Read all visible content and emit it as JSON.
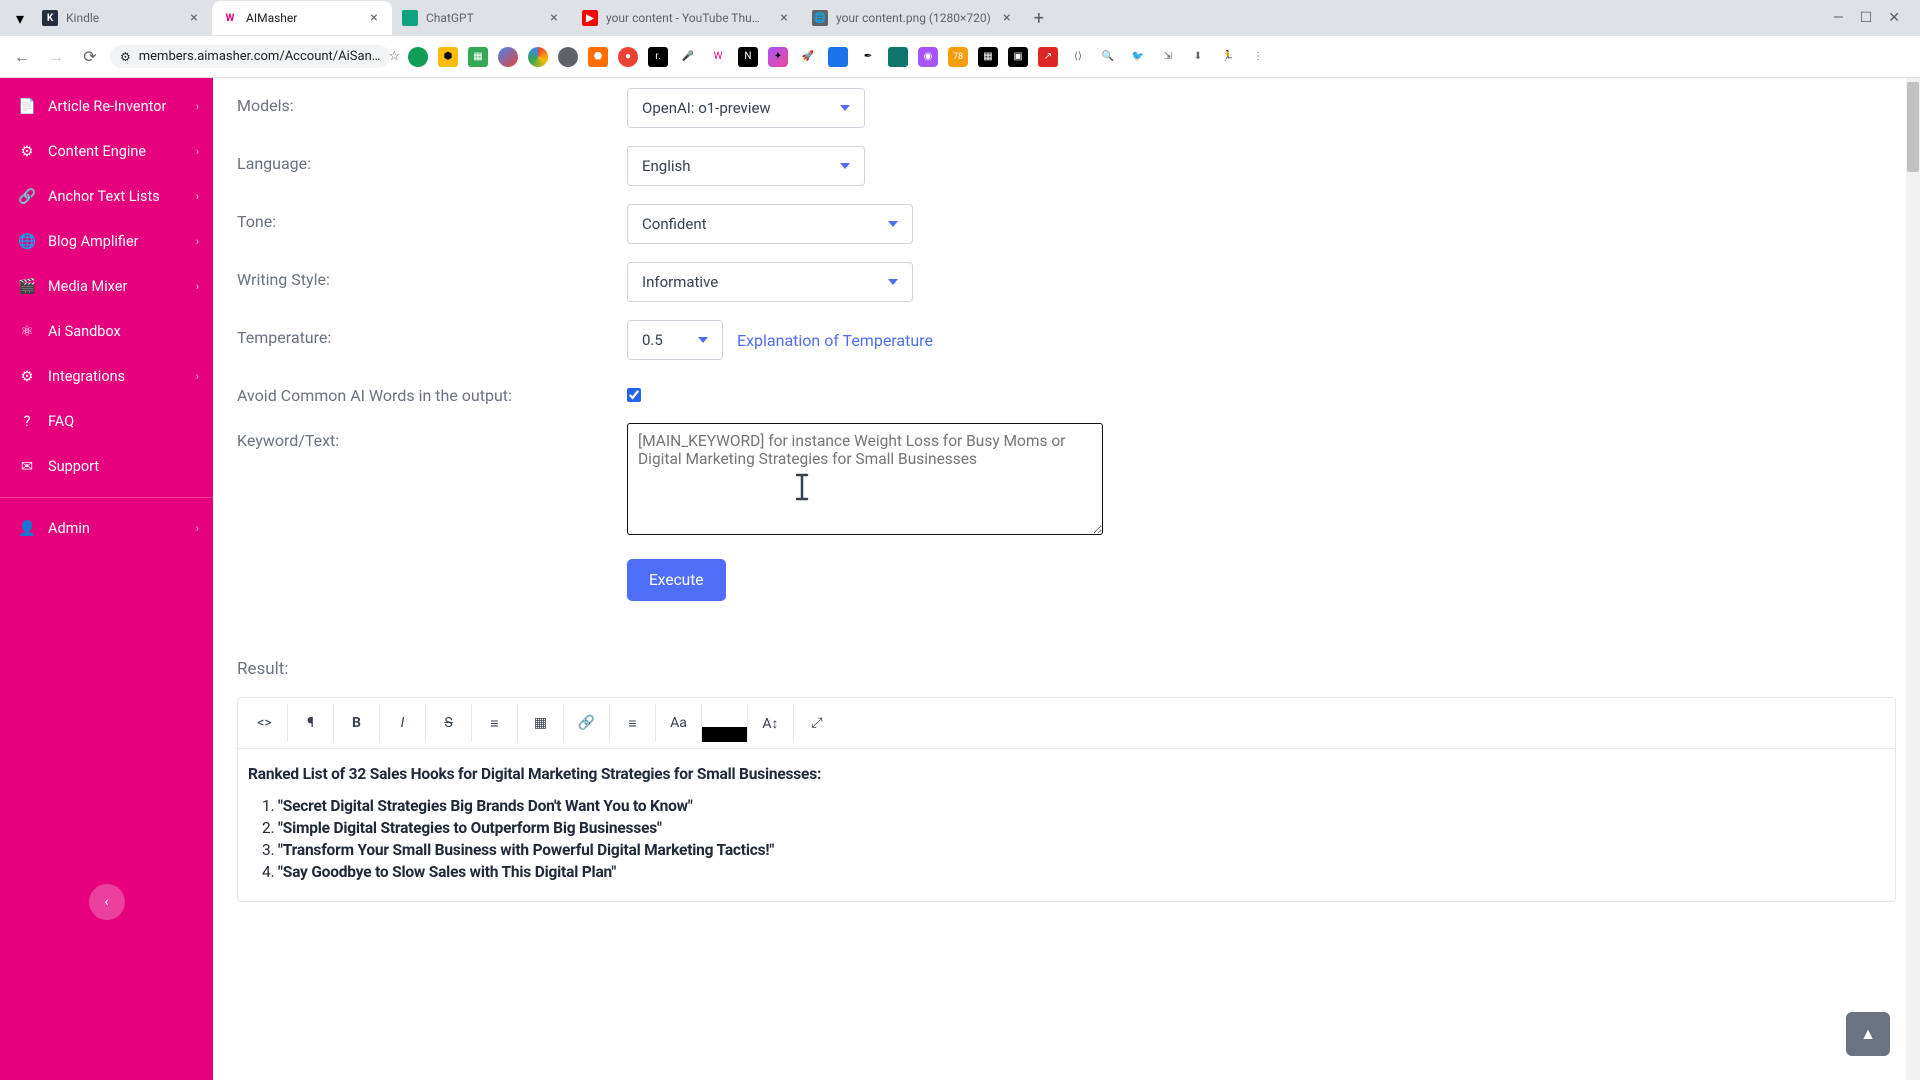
{
  "browser": {
    "tabs": [
      {
        "title": "Kindle",
        "favicon_bg": "#232f3e",
        "favicon_text": "K",
        "favicon_color": "#fff"
      },
      {
        "title": "AIMasher",
        "favicon_bg": "#fff",
        "favicon_text": "W",
        "favicon_color": "#e6007e",
        "active": true
      },
      {
        "title": "ChatGPT",
        "favicon_bg": "#10a37f",
        "favicon_text": "",
        "favicon_color": "#fff"
      },
      {
        "title": "your content - YouTube Thumb",
        "favicon_bg": "#ff0000",
        "favicon_text": "▶",
        "favicon_color": "#fff"
      },
      {
        "title": "your content.png (1280×720)",
        "favicon_bg": "#5f6368",
        "favicon_text": "🌐",
        "favicon_color": "#fff"
      }
    ],
    "url": "members.aimasher.com/Account/AiSan…"
  },
  "sidebar": {
    "items": [
      {
        "label": "Article Re-Inventor",
        "icon": "📄",
        "has_sub": true
      },
      {
        "label": "Content Engine",
        "icon": "⚙",
        "has_sub": true
      },
      {
        "label": "Anchor Text Lists",
        "icon": "🔗",
        "has_sub": true
      },
      {
        "label": "Blog Amplifier",
        "icon": "🌐",
        "has_sub": true
      },
      {
        "label": "Media Mixer",
        "icon": "🎬",
        "has_sub": true
      },
      {
        "label": "Ai Sandbox",
        "icon": "⚛",
        "has_sub": false
      },
      {
        "label": "Integrations",
        "icon": "⚙",
        "has_sub": true
      },
      {
        "label": "FAQ",
        "icon": "?",
        "has_sub": false
      },
      {
        "label": "Support",
        "icon": "✉",
        "has_sub": false
      }
    ],
    "admin": {
      "label": "Admin",
      "icon": "👤"
    }
  },
  "form": {
    "models_label": "Models:",
    "models_value": "OpenAI: o1-preview",
    "language_label": "Language:",
    "language_value": "English",
    "tone_label": "Tone:",
    "tone_value": "Confident",
    "style_label": "Writing Style:",
    "style_value": "Informative",
    "temp_label": "Temperature:",
    "temp_value": "0.5",
    "temp_link": "Explanation of Temperature",
    "avoid_label": "Avoid Common AI Words in the output:",
    "keyword_label": "Keyword/Text:",
    "keyword_placeholder": "[MAIN_KEYWORD] for instance Weight Loss for Busy Moms or Digital Marketing Strategies for Small Businesses",
    "execute_label": "Execute",
    "result_label": "Result:"
  },
  "result": {
    "title": "Ranked List of 32 Sales Hooks for Digital Marketing Strategies for Small Businesses:",
    "items": [
      "\"Secret Digital Strategies Big Brands Don't Want You to Know\"",
      "\"Simple Digital Strategies to Outperform Big Businesses\"",
      "\"Transform Your Small Business with Powerful Digital Marketing Tactics!\"",
      "\"Say Goodbye to Slow Sales with This Digital Plan\""
    ]
  }
}
